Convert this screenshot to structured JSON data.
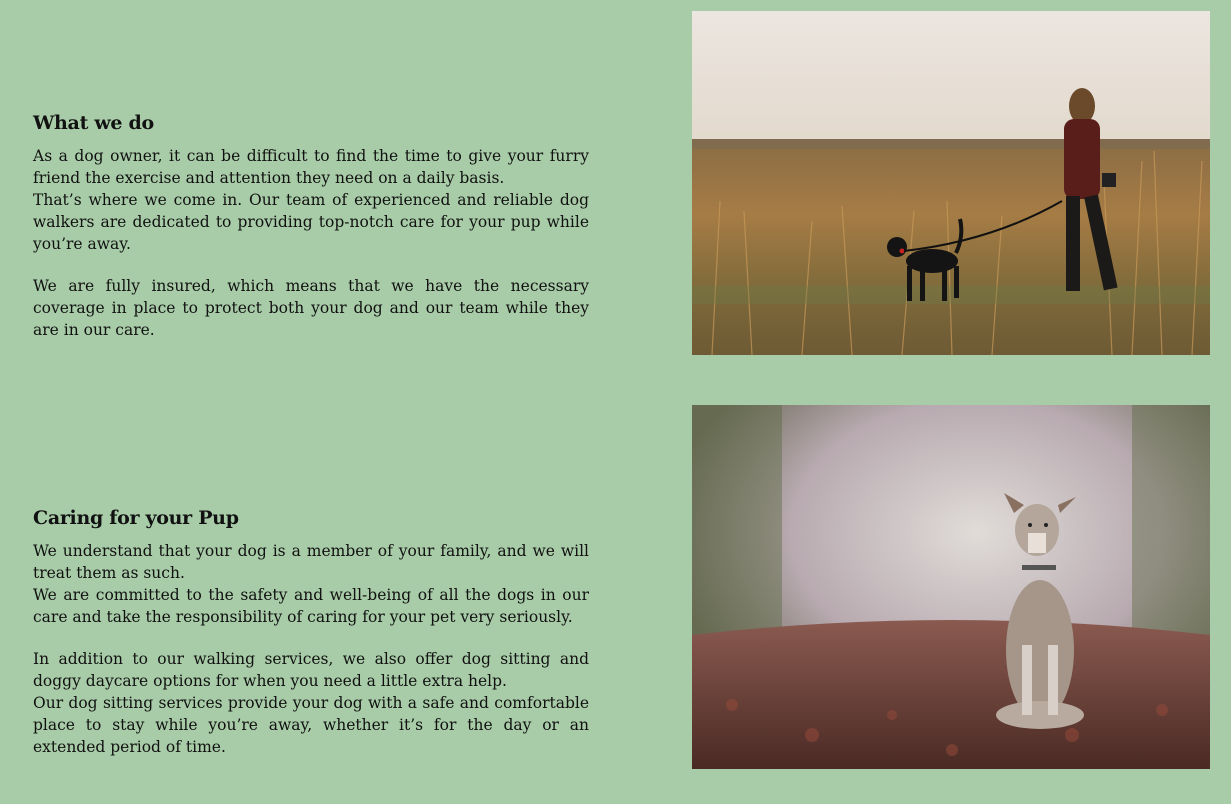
{
  "sections": [
    {
      "heading": "What we do",
      "paragraphs": [
        "As a dog owner, it can be difficult to find the time to give your furry friend the exercise and attention they need on a daily basis.",
        "That’s where we come in. Our team of experienced and reliable dog walkers are dedicated to providing top-notch care for your pup while you’re away.",
        "We are fully insured, which means that we have the necessary coverage in place to protect both your dog and our team while they are in our care."
      ],
      "image_icon": "woman-walking-dog-in-field-photo"
    },
    {
      "heading": "Caring for your Pup",
      "paragraphs": [
        "We understand that your dog is a member of your family, and we will treat them as such.",
        "We are committed to the safety and well-being of all the dogs in our care and take the responsibility of caring for your pet very seriously.",
        "In addition to our walking services, we also offer dog sitting and doggy daycare options for when you need a little extra help.",
        "Our dog sitting services provide your dog with a safe and comfortable place to stay while you’re away, whether it’s for the day or an extended period of time."
      ],
      "image_icon": "dog-sitting-in-autumn-leaves-photo"
    }
  ],
  "colors": {
    "background": "#a8cca8",
    "text": "#111111"
  }
}
